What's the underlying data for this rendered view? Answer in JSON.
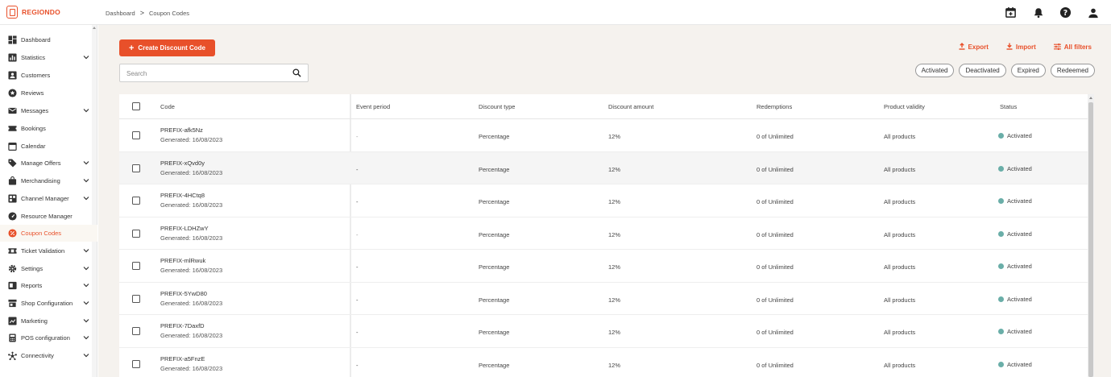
{
  "app": {
    "logo_text": "REGIONDO",
    "accent_color": "#e8502a",
    "status_color": "#6aaea8"
  },
  "breadcrumb": {
    "parent": "Dashboard",
    "separator": ">",
    "current": "Coupon Codes"
  },
  "topbar": {
    "icons": [
      "calendar-add-icon",
      "bell-icon",
      "help-icon",
      "user-icon"
    ]
  },
  "sidebar": {
    "items": [
      {
        "label": "Dashboard",
        "icon": "dashboard-icon",
        "has_chevron": false
      },
      {
        "label": "Statistics",
        "icon": "bar-chart-icon",
        "has_chevron": true
      },
      {
        "label": "Customers",
        "icon": "person-box-icon",
        "has_chevron": false
      },
      {
        "label": "Reviews",
        "icon": "star-circle-icon",
        "has_chevron": false
      },
      {
        "label": "Messages",
        "icon": "mail-icon",
        "has_chevron": true
      },
      {
        "label": "Bookings",
        "icon": "ticket-icon",
        "has_chevron": false
      },
      {
        "label": "Calendar",
        "icon": "calendar-icon",
        "has_chevron": false
      },
      {
        "label": "Manage Offers",
        "icon": "tag-icon",
        "has_chevron": true
      },
      {
        "label": "Merchandising",
        "icon": "bag-icon",
        "has_chevron": true
      },
      {
        "label": "Channel Manager",
        "icon": "grid-icon",
        "has_chevron": true
      },
      {
        "label": "Resource Manager",
        "icon": "gauge-icon",
        "has_chevron": false
      },
      {
        "label": "Coupon Codes",
        "icon": "percent-icon",
        "has_chevron": false,
        "active": true
      },
      {
        "label": "Ticket Validation",
        "icon": "ticket-check-icon",
        "has_chevron": true
      },
      {
        "label": "Settings",
        "icon": "gear-icon",
        "has_chevron": true
      },
      {
        "label": "Reports",
        "icon": "report-icon",
        "has_chevron": true
      },
      {
        "label": "Shop Configuration",
        "icon": "shop-icon",
        "has_chevron": true
      },
      {
        "label": "Marketing",
        "icon": "marketing-icon",
        "has_chevron": true
      },
      {
        "label": "POS configuration",
        "icon": "pos-icon",
        "has_chevron": true
      },
      {
        "label": "Connectivity",
        "icon": "hub-icon",
        "has_chevron": true
      }
    ]
  },
  "toolbar": {
    "create_label": "Create Discount Code",
    "search_placeholder": "Search",
    "export_label": "Export",
    "import_label": "Import",
    "filters_label": "All filters"
  },
  "chips": [
    "Activated",
    "Deactivated",
    "Expired",
    "Redeemed"
  ],
  "table": {
    "headers": {
      "code": "Code",
      "event_period": "Event period",
      "discount_type": "Discount type",
      "discount_amount": "Discount amount",
      "redemptions": "Redemptions",
      "product_validity": "Product validity",
      "status": "Status"
    },
    "rows": [
      {
        "code": "PREFIX-afk5Nz",
        "generated": "Generated: 16/08/2023",
        "event_period": "-",
        "discount_type": "Percentage",
        "discount_amount": "12%",
        "redemptions": "0 of Unlimited",
        "product_validity": "All products",
        "status": "Activated"
      },
      {
        "code": "PREFIX-xQvd0y",
        "generated": "Generated: 16/08/2023",
        "event_period": "-",
        "discount_type": "Percentage",
        "discount_amount": "12%",
        "redemptions": "0 of Unlimited",
        "product_validity": "All products",
        "status": "Activated"
      },
      {
        "code": "PREFIX-4HCtq8",
        "generated": "Generated: 16/08/2023",
        "event_period": "-",
        "discount_type": "Percentage",
        "discount_amount": "12%",
        "redemptions": "0 of Unlimited",
        "product_validity": "All products",
        "status": "Activated"
      },
      {
        "code": "PREFIX-LDHZwY",
        "generated": "Generated: 16/08/2023",
        "event_period": "-",
        "discount_type": "Percentage",
        "discount_amount": "12%",
        "redemptions": "0 of Unlimited",
        "product_validity": "All products",
        "status": "Activated"
      },
      {
        "code": "PREFIX-mlRwuk",
        "generated": "Generated: 16/08/2023",
        "event_period": "-",
        "discount_type": "Percentage",
        "discount_amount": "12%",
        "redemptions": "0 of Unlimited",
        "product_validity": "All products",
        "status": "Activated"
      },
      {
        "code": "PREFIX-5YwD80",
        "generated": "Generated: 16/08/2023",
        "event_period": "-",
        "discount_type": "Percentage",
        "discount_amount": "12%",
        "redemptions": "0 of Unlimited",
        "product_validity": "All products",
        "status": "Activated"
      },
      {
        "code": "PREFIX-7DaxfD",
        "generated": "Generated: 16/08/2023",
        "event_period": "-",
        "discount_type": "Percentage",
        "discount_amount": "12%",
        "redemptions": "0 of Unlimited",
        "product_validity": "All products",
        "status": "Activated"
      },
      {
        "code": "PREFIX-a5FnzE",
        "generated": "Generated: 16/08/2023",
        "event_period": "-",
        "discount_type": "Percentage",
        "discount_amount": "12%",
        "redemptions": "0 of Unlimited",
        "product_validity": "All products",
        "status": "Activated"
      }
    ]
  }
}
